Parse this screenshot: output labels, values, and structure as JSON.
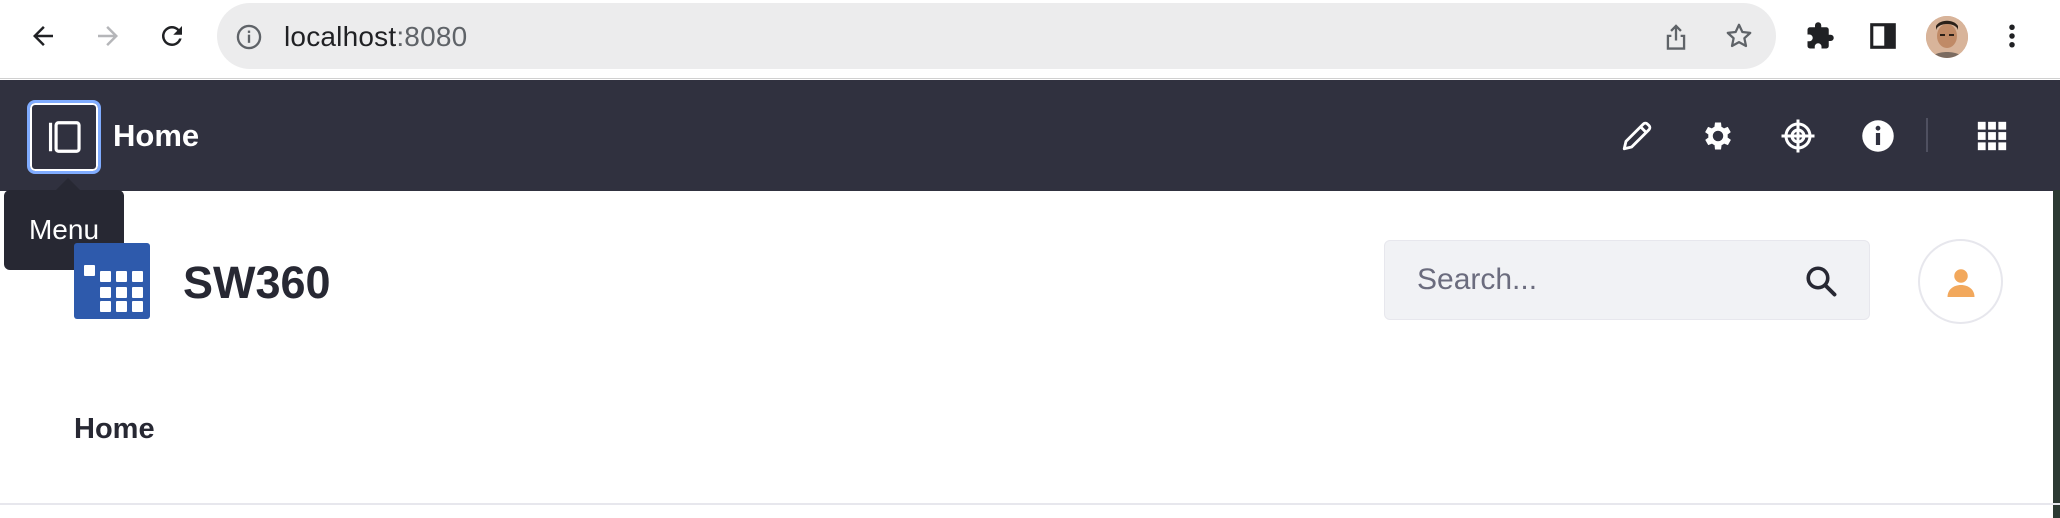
{
  "browser": {
    "url_host": "localhost",
    "url_port": ":8080"
  },
  "appbar": {
    "title": "Home"
  },
  "tooltip": {
    "text": "Menu"
  },
  "site": {
    "name": "SW360"
  },
  "search": {
    "placeholder": "Search..."
  },
  "nav": {
    "items": [
      {
        "label": "Home"
      }
    ]
  },
  "colors": {
    "appbar_bg": "#30313f",
    "logo_bg": "#2e5aac",
    "user_icon": "#f2a85c",
    "focus_ring": "#80acff"
  },
  "icons": {
    "back": "arrow-left-icon",
    "forward": "arrow-right-icon",
    "reload": "reload-icon",
    "info": "info-circle-icon",
    "share": "share-icon",
    "bookmark": "star-icon",
    "extensions": "puzzle-icon",
    "side_panel": "side-panel-icon",
    "kebab": "kebab-icon",
    "menu": "product-menu-icon",
    "edit": "pencil-icon",
    "configure": "cog-icon",
    "simulation": "simulation-icon",
    "information": "info-icon",
    "apps": "grid-icon",
    "search": "search-icon",
    "user": "user-icon"
  }
}
